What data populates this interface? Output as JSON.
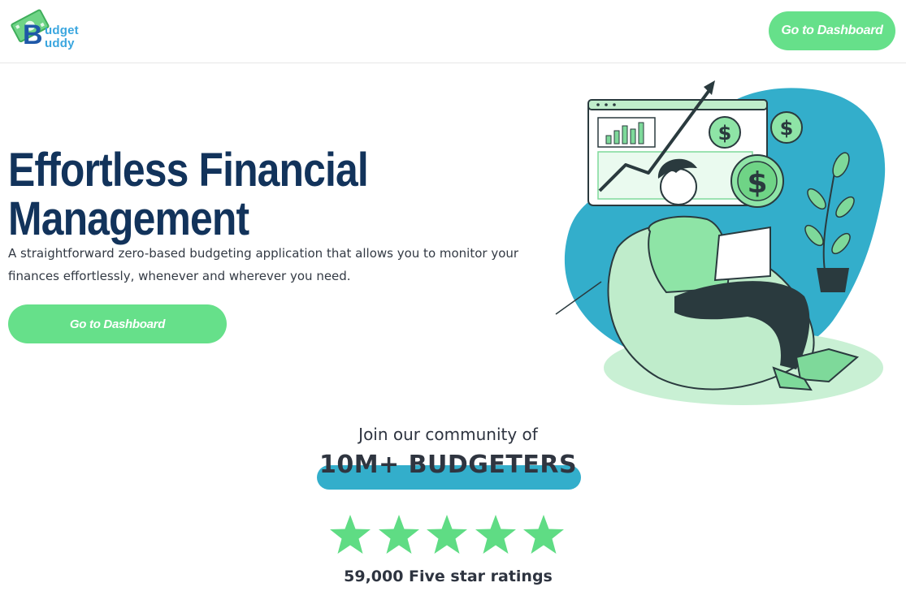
{
  "brand": {
    "logo_initial": "B",
    "logo_line1": "udget",
    "logo_line2": "uddy",
    "logo_icon": "money-bill-icon"
  },
  "header": {
    "cta_label": "Go to Dashboard"
  },
  "hero": {
    "title_line1": "Effortless Financial",
    "title_line2": "Management",
    "subtitle": "A straightforward zero-based budgeting application that allows you to monitor your finances effortlessly, whenever and wherever you need.",
    "cta_label": "Go to Dashboard",
    "illustration": "person-with-laptop-growth-chart-illustration"
  },
  "community": {
    "intro": "Join our community of",
    "count": "10M+ BUDGETERS",
    "stars": 5,
    "ratings": "59,000 Five star ratings"
  },
  "colors": {
    "accent_green": "#66e08a",
    "navy": "#12335b",
    "teal": "#33aecb",
    "star_green": "#5fdc84"
  }
}
